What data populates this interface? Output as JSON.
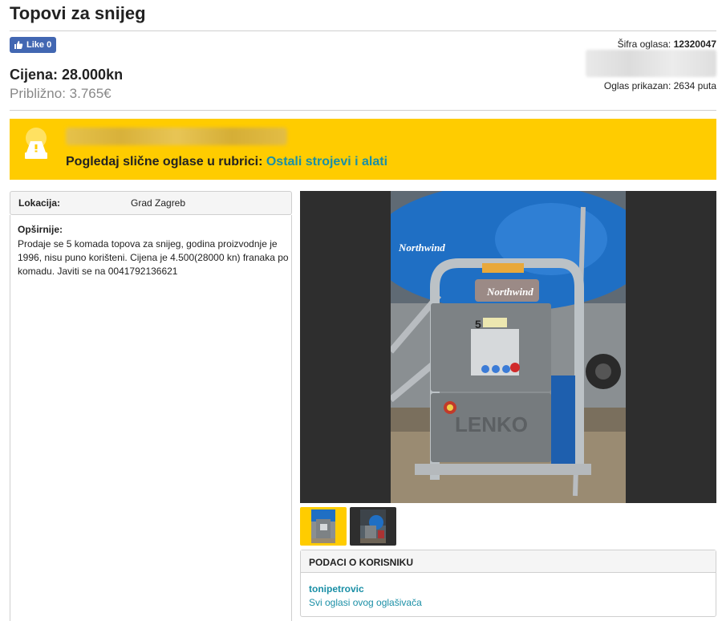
{
  "listing": {
    "title": "Topovi za snijeg",
    "price_label": "Cijena: 28.000kn",
    "approx_label": "Približno: 3.765€"
  },
  "facebook": {
    "like_label": "Like 0",
    "icon": "thumbs-up-icon"
  },
  "meta": {
    "sifra_label": "Šifra oglasa: ",
    "sifra_value": "12320047",
    "views_label": "Oglas prikazan: 2634 puta"
  },
  "banner": {
    "text": "Pogledaj slične oglase u rubrici: ",
    "category_link": "Ostali strojevi i alati",
    "icon": "alert-banner-icon",
    "color": "#ffcc00"
  },
  "details": {
    "location_label": "Lokacija:",
    "location_value": "Grad Zagreb",
    "description_label": "Opširnije:",
    "description_text": "Prodaje se 5 komada topova za snijeg, godina proizvodnje je 1996, nisu puno korišteni. Cijena je 4.500(28000 kn) franaka po komadu. Javiti se na 0041792136621"
  },
  "gallery": {
    "photo_text_1": "Northwind",
    "photo_text_2": "Northwind",
    "photo_text_3": "LENKO",
    "photo_text_4": "5",
    "thumbnails": 2,
    "selected_index": 0
  },
  "user": {
    "section_title": "PODACI O KORISNIKU",
    "username": "tonipetrovic",
    "all_ads_link": "Svi oglasi ovog oglašivača"
  },
  "colors": {
    "accent": "#ffcc00",
    "link": "#1a8fa6",
    "facebook": "#4267b2"
  }
}
